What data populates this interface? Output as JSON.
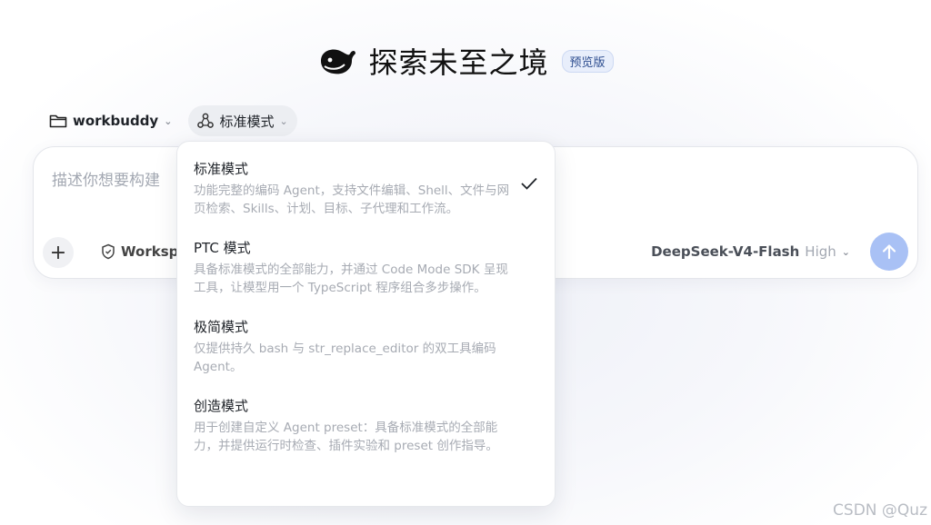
{
  "header": {
    "title": "探索未至之境",
    "badge": "预览版",
    "logo_icon": "whale-logo-icon"
  },
  "toolbar": {
    "folder": {
      "icon": "folder-icon",
      "label": "workbuddy"
    },
    "mode": {
      "icon": "agent-mode-icon",
      "label": "标准模式"
    }
  },
  "input": {
    "placeholder": "描述你想要构建",
    "workspace_label": "Workspa",
    "model_name": "DeepSeek-V4-Flash",
    "model_level": "High"
  },
  "dropdown": {
    "options": [
      {
        "title": "标准模式",
        "desc": "功能完整的编码 Agent，支持文件编辑、Shell、文件与网页检索、Skills、计划、目标、子代理和工作流。",
        "selected": true
      },
      {
        "title": "PTC 模式",
        "desc": "具备标准模式的全部能力，并通过 Code Mode SDK 呈现工具，让模型用一个 TypeScript 程序组合多步操作。",
        "selected": false
      },
      {
        "title": "极简模式",
        "desc": "仅提供持久 bash 与 str_replace_editor 的双工具编码 Agent。",
        "selected": false
      },
      {
        "title": "创造模式",
        "desc": "用于创建自定义 Agent preset：具备标准模式的全部能力，并提供运行时检查、插件实验和 preset 创作指导。",
        "selected": false
      }
    ]
  },
  "watermark": "CSDN @Quz",
  "colors": {
    "accent": "#a9c1f5",
    "badge_bg": "#e8eefb"
  }
}
